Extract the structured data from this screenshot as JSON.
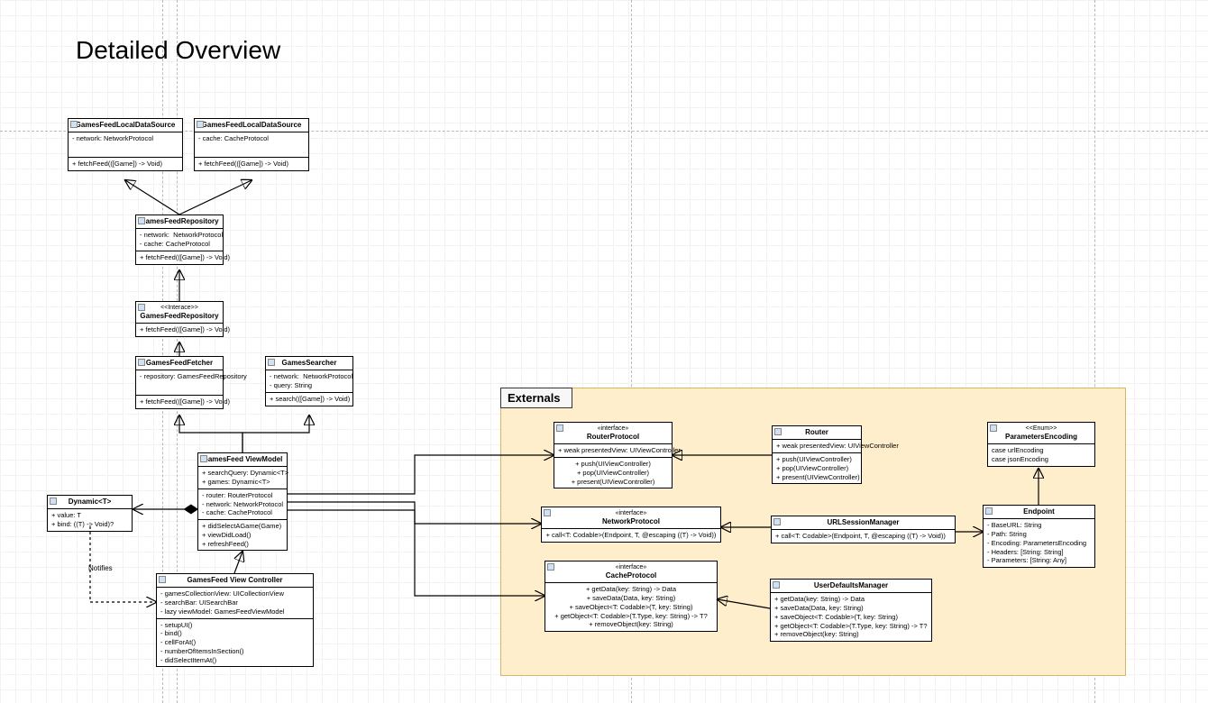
{
  "title": "Detailed Overview",
  "externals_label": "Externals",
  "guides": {
    "v": [
      180,
      196,
      700,
      1214
    ],
    "h": [
      145
    ]
  },
  "boxes": {
    "ds_net": {
      "title": "GamesFeedLocalDataSource",
      "attrs": "- network: NetworkProtocol",
      "ops": "+ fetchFeed(([Game]) -> Void)"
    },
    "ds_cache": {
      "title": "GamesFeedLocalDataSource",
      "attrs": "- cache: CacheProtocol",
      "ops": "+ fetchFeed(([Game]) -> Void)"
    },
    "repo": {
      "title": "GamesFeedRepository",
      "attrs": "- network:  NetworkProtocol\n- cache: CacheProtocol",
      "ops": "+ fetchFeed(([Game]) -> Void)"
    },
    "repo_if": {
      "stereo": "<<Interace>>",
      "title": "GamesFeedRepository",
      "ops": "+ fetchFeed(([Game]) -> Void)"
    },
    "fetcher": {
      "title": "GamesFeedFetcher",
      "attrs": "- repository: GamesFeedRepository",
      "ops": "+ fetchFeed(([Game]) -> Void)"
    },
    "searcher": {
      "title": "GamesSearcher",
      "attrs": "- network:  NetworkProtocol\n- query: String",
      "ops": "+ search(([Game]) -> Void)"
    },
    "dynamic": {
      "title": "Dynamic<T>",
      "attrs": "+ value: T\n+ bind: ((T) -> Void)?"
    },
    "vm": {
      "title": "GamesFeed ViewModel",
      "attrs1": "+ searchQuery: Dynamic<T>\n+ games: Dynamic<T>",
      "attrs2": "- router: RouterProtocol\n- network: NetworkProtocol\n- cache: CacheProtocol",
      "ops": "+ didSelectAGame(Game)\n+ viewDidLoad()\n+ refreshFeed()"
    },
    "vc": {
      "title": "GamesFeed View Controller",
      "attrs": "- gamesCollectionView: UICollectionView\n- searchBar: UISearchBar\n- lazy viewModel: GamesFeedViewModel",
      "ops": "- setupUI()\n- bind()\n- cellForAt()\n- numberOfItemsInSection()\n- didSelectItemAt()"
    },
    "router_if": {
      "stereo": "«interface»",
      "title": "RouterProtocol",
      "attrs": "+ weak presentedView: UIViewController",
      "ops": "+ push(UIViewController)\n+ pop(UIViewController)\n+ present(UIViewController)"
    },
    "net_if": {
      "stereo": "«interface»",
      "title": "NetworkProtocol",
      "ops": "+ call<T: Codable>(Endpoint, T, @escaping ((T) -> Void))"
    },
    "cache_if": {
      "stereo": "«interface»",
      "title": "CacheProtocol",
      "ops": "+ getData(key: String) -> Data\n+ saveData(Data, key: String)\n+ saveObject<T: Codable>(T, key: String)\n+ getObject<T: Codable>(T.Type, key: String) -> T?\n+ removeObject(key: String)"
    },
    "router": {
      "title": "Router",
      "attrs": "+ weak presentedView: UIViewController",
      "ops": "+ push(UIViewController)\n+ pop(UIViewController)\n+ present(UIViewController)"
    },
    "session": {
      "title": "URLSessionManager",
      "ops": "+ call<T: Codable>(Endpoint, T, @escaping ((T) -> Void))"
    },
    "defaults": {
      "title": "UserDefaultsManager",
      "ops": "+ getData(key: String) -> Data\n+ saveData(Data, key: String)\n+ saveObject<T: Codable>(T, key: String)\n+ getObject<T: Codable>(T.Type, key: String) -> T?\n+ removeObject(key: String)"
    },
    "pencode": {
      "stereo": "<<Enum>>",
      "title": "ParametersEncoding",
      "ops": "case urlEncoding\ncase jsonEncoding"
    },
    "endpoint": {
      "title": "Endpoint",
      "attrs": "- BaseURL: String\n- Path: String\n- Encoding: ParametersEncoding\n- Headers: [String: String]\n- Parameters: [String: Any]"
    }
  },
  "notifies": "Notifies"
}
